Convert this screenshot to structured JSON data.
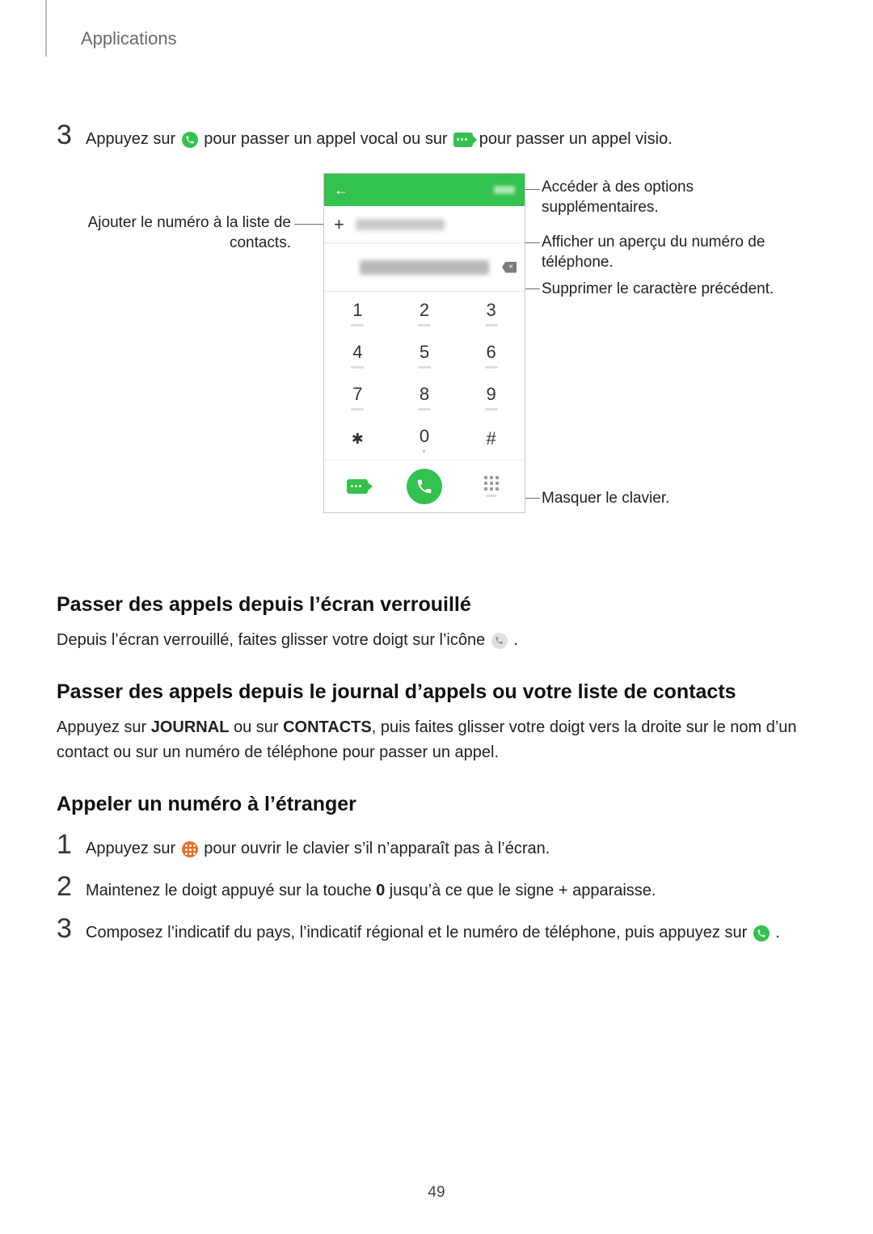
{
  "header": {
    "section": "Applications"
  },
  "step3": {
    "num": "3",
    "t1": "Appuyez sur ",
    "t2": " pour passer un appel vocal ou sur ",
    "t3": " pour passer un appel visio."
  },
  "callouts": {
    "addContacts": "Ajouter le numéro à la liste de contacts.",
    "options": "Accéder à des options supplémentaires.",
    "preview": "Afficher un aperçu du numéro de téléphone.",
    "backspace": "Supprimer le caractère précédent.",
    "hideKbd": "Masquer le clavier."
  },
  "keypad": {
    "k1": "1",
    "k2": "2",
    "k3": "3",
    "k4": "4",
    "k5": "5",
    "k6": "6",
    "k7": "7",
    "k8": "8",
    "k9": "9",
    "kstar": "✱",
    "k0": "0",
    "khash": "#",
    "plus": "+",
    "back": "←"
  },
  "sectionA": {
    "title": "Passer des appels depuis l’écran verrouillé",
    "p1a": "Depuis l’écran verrouillé, faites glisser votre doigt sur l’icône ",
    "p1b": "."
  },
  "sectionB": {
    "title": "Passer des appels depuis le journal d’appels ou votre liste de contacts",
    "p_a": "Appuyez sur ",
    "p_j": "JOURNAL",
    "p_b": " ou sur ",
    "p_c": "CONTACTS",
    "p_d": ", puis faites glisser votre doigt vers la droite sur le nom d’un contact ou sur un numéro de téléphone pour passer un appel."
  },
  "sectionC": {
    "title": "Appeler un numéro à l’étranger",
    "s1": {
      "num": "1",
      "a": "Appuyez sur ",
      "b": " pour ouvrir le clavier s’il n’apparaît pas à l’écran."
    },
    "s2": {
      "num": "2",
      "a": "Maintenez le doigt appuyé sur la touche ",
      "zero": "0",
      "b": " jusqu’à ce que le signe + apparaisse."
    },
    "s3": {
      "num": "3",
      "a": "Composez l’indicatif du pays, l’indicatif régional et le numéro de téléphone, puis appuyez sur ",
      "b": "."
    }
  },
  "pageNumber": "49"
}
